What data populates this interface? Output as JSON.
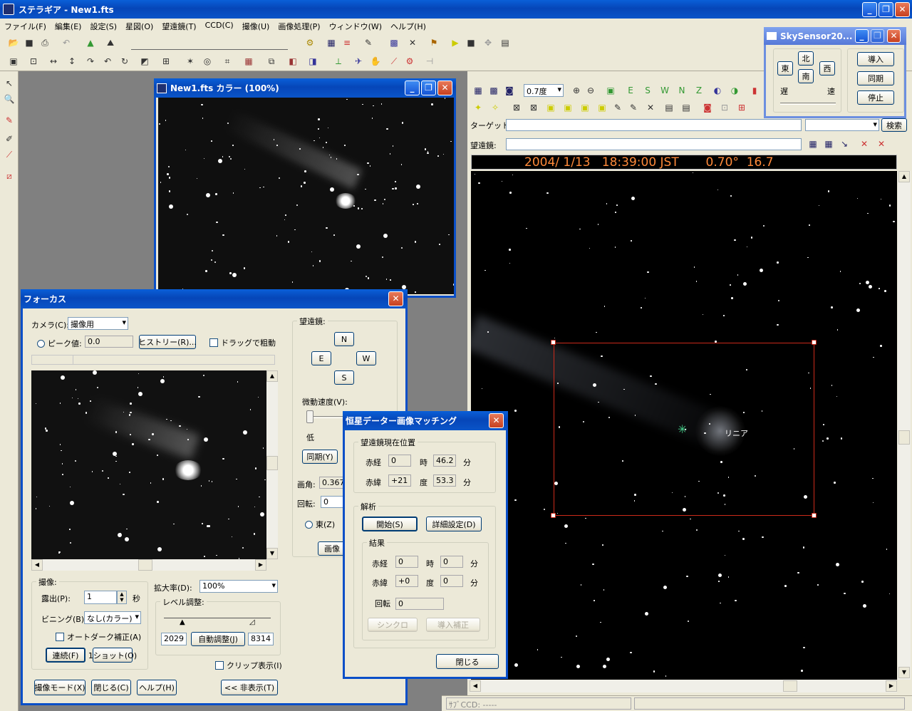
{
  "app": {
    "title": "ステラギア - New1.fts"
  },
  "menu": [
    "ファイル(F)",
    "編集(E)",
    "設定(S)",
    "星図(O)",
    "望遠鏡(T)",
    "CCD(C)",
    "撮像(U)",
    "画像処理(P)",
    "ウィンドウ(W)",
    "ヘルプ(H)"
  ],
  "image_window": {
    "title": "New1.fts カラー (100%)"
  },
  "chart_panel": {
    "zoom_value": "0.7度",
    "toolbar_letters": [
      "E",
      "S",
      "W",
      "N",
      "Z"
    ],
    "target_label": "ターゲット:",
    "telescope_label": "望遠鏡:",
    "search_label": "検索",
    "info_bar": "2004/ 1/13   18:39:00 JST       0.70°  16.7",
    "object_label": "リニア",
    "status_text": "ｻﾌﾞCCD: -----"
  },
  "skysensor": {
    "title": "SkySensor20...",
    "north": "北",
    "east": "東",
    "south": "南",
    "west": "西",
    "slow": "遅",
    "fast": "速",
    "goto": "導入",
    "sync": "同期",
    "stop": "停止"
  },
  "focus": {
    "title": "フォーカス",
    "camera_label": "カメラ(C):",
    "camera_value": "撮像用",
    "peak_label": "ピーク値:",
    "peak_value": "0.0",
    "history_button": "ヒストリー(R)...",
    "drag_label": "ドラッグで粗動",
    "telescope_group": "望遠鏡:",
    "dir_n": "N",
    "dir_e": "E",
    "dir_w": "W",
    "dir_s": "S",
    "speed_label": "微動速度(V):",
    "speed_low": "低",
    "sync_button": "同期(Y)",
    "angle_label": "画角:",
    "angle_value": "0.367",
    "rotation_label": "回転:",
    "rotation_value": "0",
    "east_label": "東(Z)",
    "image_button": "画像",
    "capture_group": "撮像:",
    "exposure_label": "露出(P):",
    "exposure_value": "1",
    "exposure_unit": "秒",
    "binning_label": "ビニング(B):",
    "binning_value": "なし(カラー)",
    "autodark_label": "オートダーク補正(A)",
    "continuous_button": "連続(F)",
    "oneshot_button": "1ショット(O)",
    "zoom_label": "拡大率(D):",
    "zoom_value": "100%",
    "level_group": "レベル調整:",
    "level_low": "2029",
    "level_high": "8314",
    "auto_button": "自動調整(J)",
    "clip_label": "クリップ表示(I)",
    "mode_button": "撮像モード(X)",
    "close_button": "閉じる(C)",
    "help_button": "ヘルプ(H)",
    "hide_button": "<< 非表示(T)"
  },
  "matching": {
    "title": "恒星データー画像マッチング",
    "position_group": "望遠鏡現在位置",
    "ra_label": "赤経",
    "ra_h": "0",
    "ra_h_unit": "時",
    "ra_m": "46.2",
    "ra_m_unit": "分",
    "dec_label": "赤緯",
    "dec_d": "+21",
    "dec_d_unit": "度",
    "dec_m": "53.3",
    "dec_m_unit": "分",
    "analysis_group": "解析",
    "start_button": "開始(S)",
    "detail_button": "詳細設定(D)",
    "result_group": "結果",
    "r_ra_h": "0",
    "r_ra_m": "0",
    "r_dec_d": "+0",
    "r_dec_m": "0",
    "rotation_label": "回転",
    "r_rotation": "0",
    "sync_button": "シンクロ",
    "goto_button": "導入補正",
    "close_button": "閉じる"
  }
}
